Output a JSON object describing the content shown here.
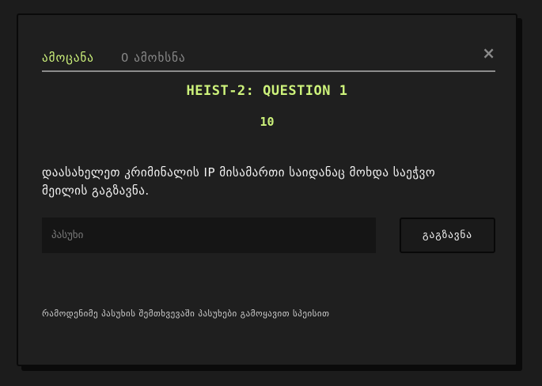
{
  "tabs": {
    "challenge": "ამოცანა",
    "solves": "0 ამოხსნა"
  },
  "close_icon": "×",
  "challenge": {
    "title": "HEIST-2: QUESTION 1",
    "points": "10",
    "description": "დაასახელეთ კრიმინალის IP მისამართი საიდანაც მოხდა საეჭვო მეილის გაგზავნა."
  },
  "answer_input": {
    "value": "",
    "placeholder": "პასუხი"
  },
  "submit_label": "გაგზავნა",
  "footer_note": "რამოდენიმე პასუხის შემთხვევაში პასუხები გამოყავით სპეისით",
  "colors": {
    "accent": "#cdf27b",
    "background": "#1f1f1f",
    "input_background": "#151515"
  }
}
